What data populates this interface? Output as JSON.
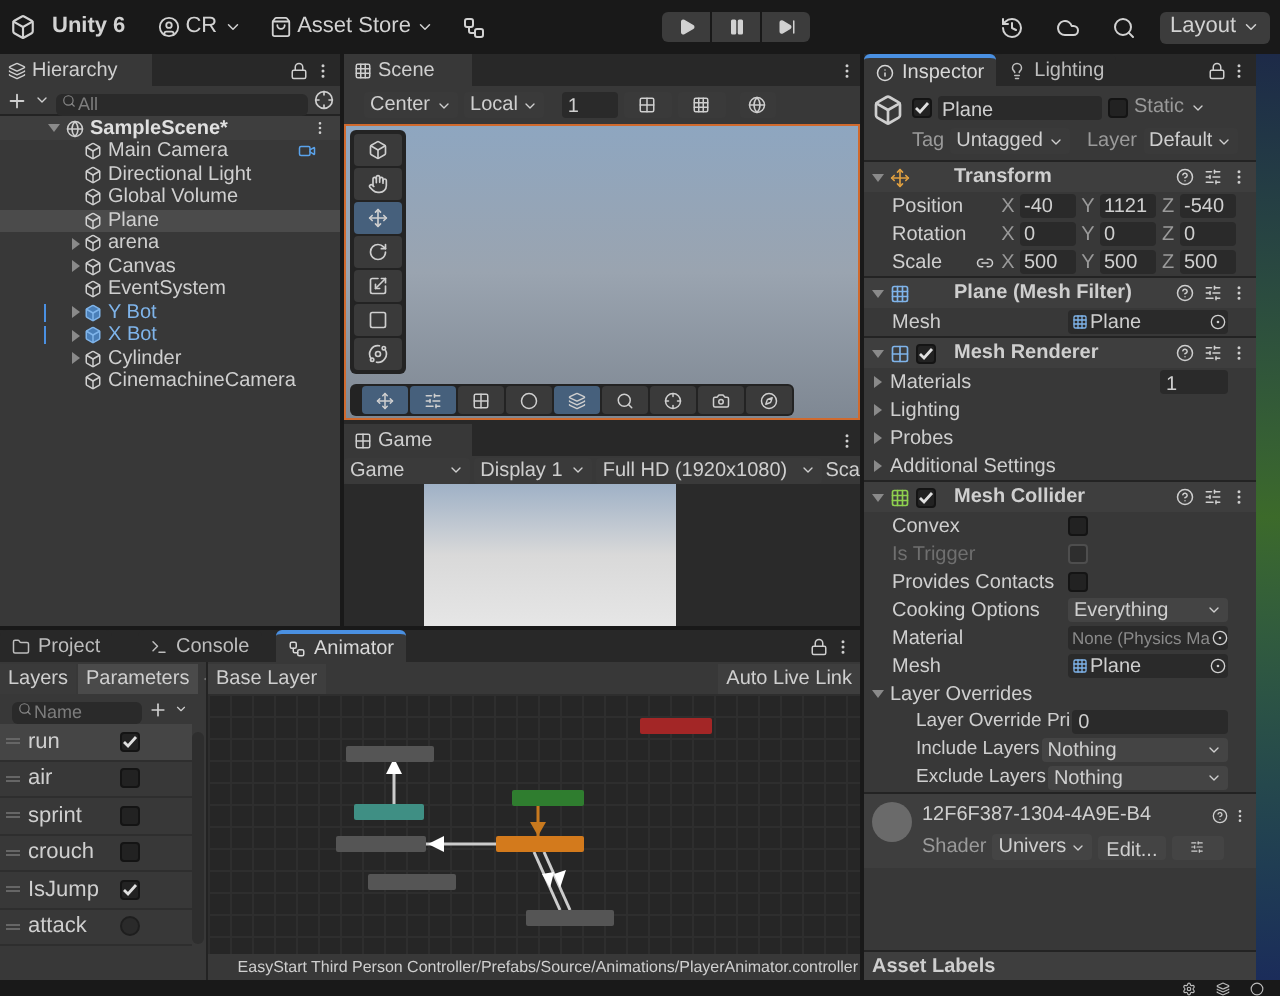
{
  "toolbar": {
    "app": "Unity 6",
    "account": "CR",
    "store": "Asset Store",
    "layout": "Layout"
  },
  "hierarchy": {
    "tab": "Hierarchy",
    "search_placeholder": "All",
    "scene": "SampleScene*",
    "items": [
      {
        "label": "Main Camera",
        "kind": "object",
        "expandable": false,
        "selected": false,
        "badge": true
      },
      {
        "label": "Directional Light",
        "kind": "object",
        "expandable": false,
        "selected": false,
        "badge": false
      },
      {
        "label": "Global Volume",
        "kind": "object",
        "expandable": false,
        "selected": false,
        "badge": false
      },
      {
        "label": "Plane",
        "kind": "object",
        "expandable": false,
        "selected": true,
        "badge": false
      },
      {
        "label": "arena",
        "kind": "object",
        "expandable": true,
        "selected": false,
        "badge": false
      },
      {
        "label": "Canvas",
        "kind": "object",
        "expandable": true,
        "selected": false,
        "badge": false
      },
      {
        "label": "EventSystem",
        "kind": "object",
        "expandable": false,
        "selected": false,
        "badge": false
      },
      {
        "label": "Y Bot",
        "kind": "prefab",
        "expandable": true,
        "selected": false,
        "badge": false
      },
      {
        "label": "X Bot",
        "kind": "prefab",
        "expandable": true,
        "selected": false,
        "badge": false
      },
      {
        "label": "Cylinder",
        "kind": "object",
        "expandable": true,
        "selected": false,
        "badge": false
      },
      {
        "label": "CinemachineCamera",
        "kind": "object",
        "expandable": false,
        "selected": false,
        "badge": false
      }
    ]
  },
  "scene": {
    "tab": "Scene",
    "pivot": "Center",
    "space": "Local",
    "snap": "1",
    "tools": [
      {
        "kind": "view",
        "selected": false
      },
      {
        "kind": "hand",
        "selected": false
      },
      {
        "kind": "move",
        "selected": true
      },
      {
        "kind": "rotate",
        "selected": false
      },
      {
        "kind": "scale",
        "selected": false
      },
      {
        "kind": "rect",
        "selected": false
      },
      {
        "kind": "transform",
        "selected": false
      }
    ],
    "overlay": [
      {
        "kind": "move",
        "selected": true
      },
      {
        "kind": "sliders",
        "selected": true
      },
      {
        "kind": "grid",
        "selected": false
      },
      {
        "kind": "sphere",
        "selected": false
      },
      {
        "kind": "layers",
        "selected": true
      },
      {
        "kind": "search",
        "selected": false
      },
      {
        "kind": "pivot",
        "selected": false
      },
      {
        "kind": "camera",
        "selected": false
      },
      {
        "kind": "compass",
        "selected": false
      }
    ]
  },
  "game": {
    "tab": "Game",
    "mode": "Game",
    "display": "Display 1",
    "resolution": "Full HD (1920x1080)",
    "scale": "Sca"
  },
  "inspector": {
    "tabs": [
      {
        "label": "Inspector",
        "selected": true
      },
      {
        "label": "Lighting",
        "selected": false
      }
    ],
    "object": {
      "active": true,
      "name": "Plane",
      "static_label": "Static",
      "static": false,
      "tag_label": "Tag",
      "tag": "Untagged",
      "layer_label": "Layer",
      "layer": "Default"
    },
    "components": [
      {
        "kind": "transform",
        "title": "Transform",
        "rows": [
          {
            "label": "Position",
            "linked": false,
            "values": [
              {
                "axis": "X",
                "value": "-40"
              },
              {
                "axis": "Y",
                "value": "1121"
              },
              {
                "axis": "Z",
                "value": "-540"
              }
            ]
          },
          {
            "label": "Rotation",
            "linked": false,
            "values": [
              {
                "axis": "X",
                "value": "0"
              },
              {
                "axis": "Y",
                "value": "0"
              },
              {
                "axis": "Z",
                "value": "0"
              }
            ]
          },
          {
            "label": "Scale",
            "linked": true,
            "values": [
              {
                "axis": "X",
                "value": "500"
              },
              {
                "axis": "Y",
                "value": "500"
              },
              {
                "axis": "Z",
                "value": "500"
              }
            ]
          }
        ]
      },
      {
        "kind": "mesh_filter",
        "title": "Plane (Mesh Filter)",
        "fields": [
          {
            "kind": "object",
            "label": "Mesh",
            "value": "Plane",
            "empty": false
          }
        ]
      },
      {
        "kind": "mesh_renderer",
        "title": "Mesh Renderer",
        "enabled": true,
        "fields": [
          {
            "kind": "foldout",
            "label": "Materials",
            "expanded": false,
            "value": "1"
          },
          {
            "kind": "foldout",
            "label": "Lighting",
            "expanded": false
          },
          {
            "kind": "foldout",
            "label": "Probes",
            "expanded": false
          },
          {
            "kind": "foldout",
            "label": "Additional Settings",
            "expanded": false
          }
        ]
      },
      {
        "kind": "mesh_collider",
        "title": "Mesh Collider",
        "enabled": true,
        "fields": [
          {
            "kind": "checkbox",
            "label": "Convex",
            "checked": false,
            "disabled": false
          },
          {
            "kind": "checkbox",
            "label": "Is Trigger",
            "checked": false,
            "disabled": true
          },
          {
            "kind": "checkbox",
            "label": "Provides Contacts",
            "checked": false,
            "disabled": false
          },
          {
            "kind": "dropdown",
            "label": "Cooking Options",
            "value": "Everything"
          },
          {
            "kind": "object",
            "label": "Material",
            "value": "None (Physics Ma",
            "empty": true
          },
          {
            "kind": "object",
            "label": "Mesh",
            "value": "Plane",
            "empty": false
          },
          {
            "kind": "foldout",
            "label": "Layer Overrides",
            "expanded": true,
            "children": [
              {
                "kind": "text",
                "label": "Layer Override Pri",
                "value": "0"
              },
              {
                "kind": "dropdown",
                "label": "Include Layers",
                "value": "Nothing"
              },
              {
                "kind": "dropdown",
                "label": "Exclude Layers",
                "value": "Nothing"
              }
            ]
          }
        ]
      }
    ],
    "material": {
      "name": "12F6F387-1304-4A9E-B4",
      "shader_label": "Shader",
      "shader": "Univers",
      "edit": "Edit..."
    },
    "asset_labels": "Asset Labels"
  },
  "animator": {
    "tabs": [
      {
        "label": "Project",
        "selected": false
      },
      {
        "label": "Console",
        "selected": false
      },
      {
        "label": "Animator",
        "selected": true
      }
    ],
    "subtabs": [
      {
        "label": "Layers",
        "selected": false
      },
      {
        "label": "Parameters",
        "selected": true
      }
    ],
    "breadcrumb": "Base Layer",
    "live_link": "Auto Live Link",
    "search_placeholder": "Name",
    "parameters": [
      {
        "name": "run",
        "kind": "bool",
        "value": true,
        "selected": true
      },
      {
        "name": "air",
        "kind": "bool",
        "value": false,
        "selected": false
      },
      {
        "name": "sprint",
        "kind": "bool",
        "value": false,
        "selected": false
      },
      {
        "name": "crouch",
        "kind": "bool",
        "value": false,
        "selected": false
      },
      {
        "name": "IsJump",
        "kind": "bool",
        "value": true,
        "selected": false
      },
      {
        "name": "attack",
        "kind": "trigger",
        "value": false,
        "selected": false
      }
    ],
    "nodes": [
      {
        "color": "#a32626"
      },
      {
        "color": "#555555"
      },
      {
        "color": "#3f8f84"
      },
      {
        "color": "#2f7d2f"
      },
      {
        "color": "#555555"
      },
      {
        "color": "#d37a1c"
      },
      {
        "color": "#555555"
      },
      {
        "color": "#555555"
      }
    ],
    "path": "EasyStart Third Person Controller/Prefabs/Source/Animations/PlayerAnimator.controller"
  }
}
